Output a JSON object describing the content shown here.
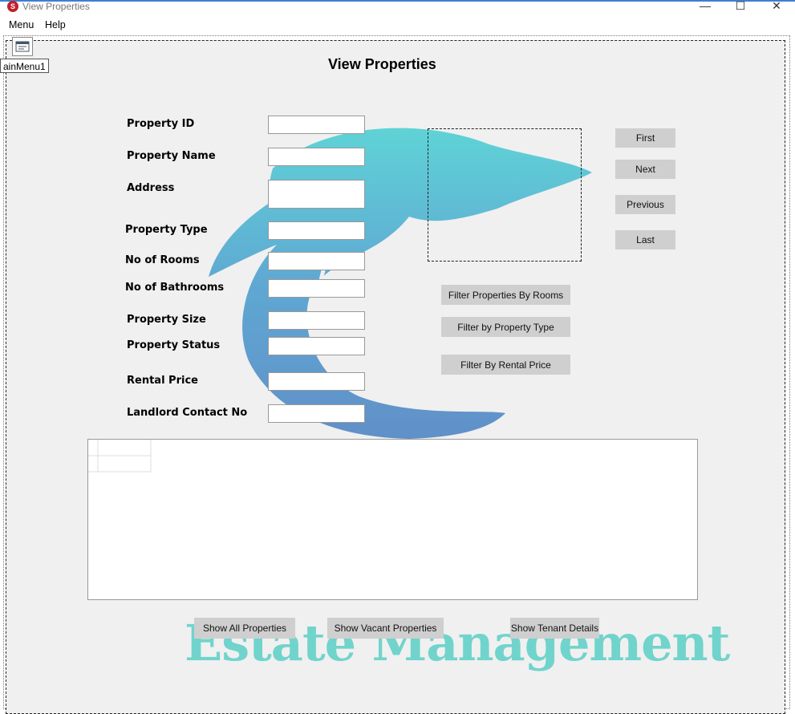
{
  "window": {
    "title": "View Properties",
    "controls": {
      "minimize": "—",
      "maximize": "☐",
      "close": "✕"
    }
  },
  "menu": {
    "items": [
      "Menu",
      "Help"
    ]
  },
  "designer": {
    "component_label": "ainMenu1"
  },
  "page_title": "View Properties",
  "form": {
    "fields": [
      {
        "label": "Property ID",
        "value": ""
      },
      {
        "label": "Property Name",
        "value": ""
      },
      {
        "label": "Address",
        "value": ""
      },
      {
        "label": "Property Type",
        "value": ""
      },
      {
        "label": "No of Rooms",
        "value": ""
      },
      {
        "label": "No of Bathrooms",
        "value": ""
      },
      {
        "label": "Property Size",
        "value": ""
      },
      {
        "label": "Property Status",
        "value": ""
      },
      {
        "label": "Rental Price",
        "value": ""
      },
      {
        "label": "Landlord Contact No",
        "value": ""
      }
    ]
  },
  "navigation": {
    "first": "First",
    "next": "Next",
    "previous": "Previous",
    "last": "Last"
  },
  "filters": {
    "by_rooms": "Filter Properties By Rooms",
    "by_type": "Filter by Property Type",
    "by_price": "Filter By Rental Price"
  },
  "bottom_buttons": {
    "show_all": "Show All Properties",
    "show_vacant": "Show Vacant Properties",
    "show_tenant": "Show Tenant Details"
  },
  "watermark": {
    "text": "Estate Management",
    "color": "#70d4cc"
  },
  "colors": {
    "button_bg": "#cfcfcf",
    "form_bg": "#f0f0f0",
    "dolphin": "#5bbfcf"
  }
}
